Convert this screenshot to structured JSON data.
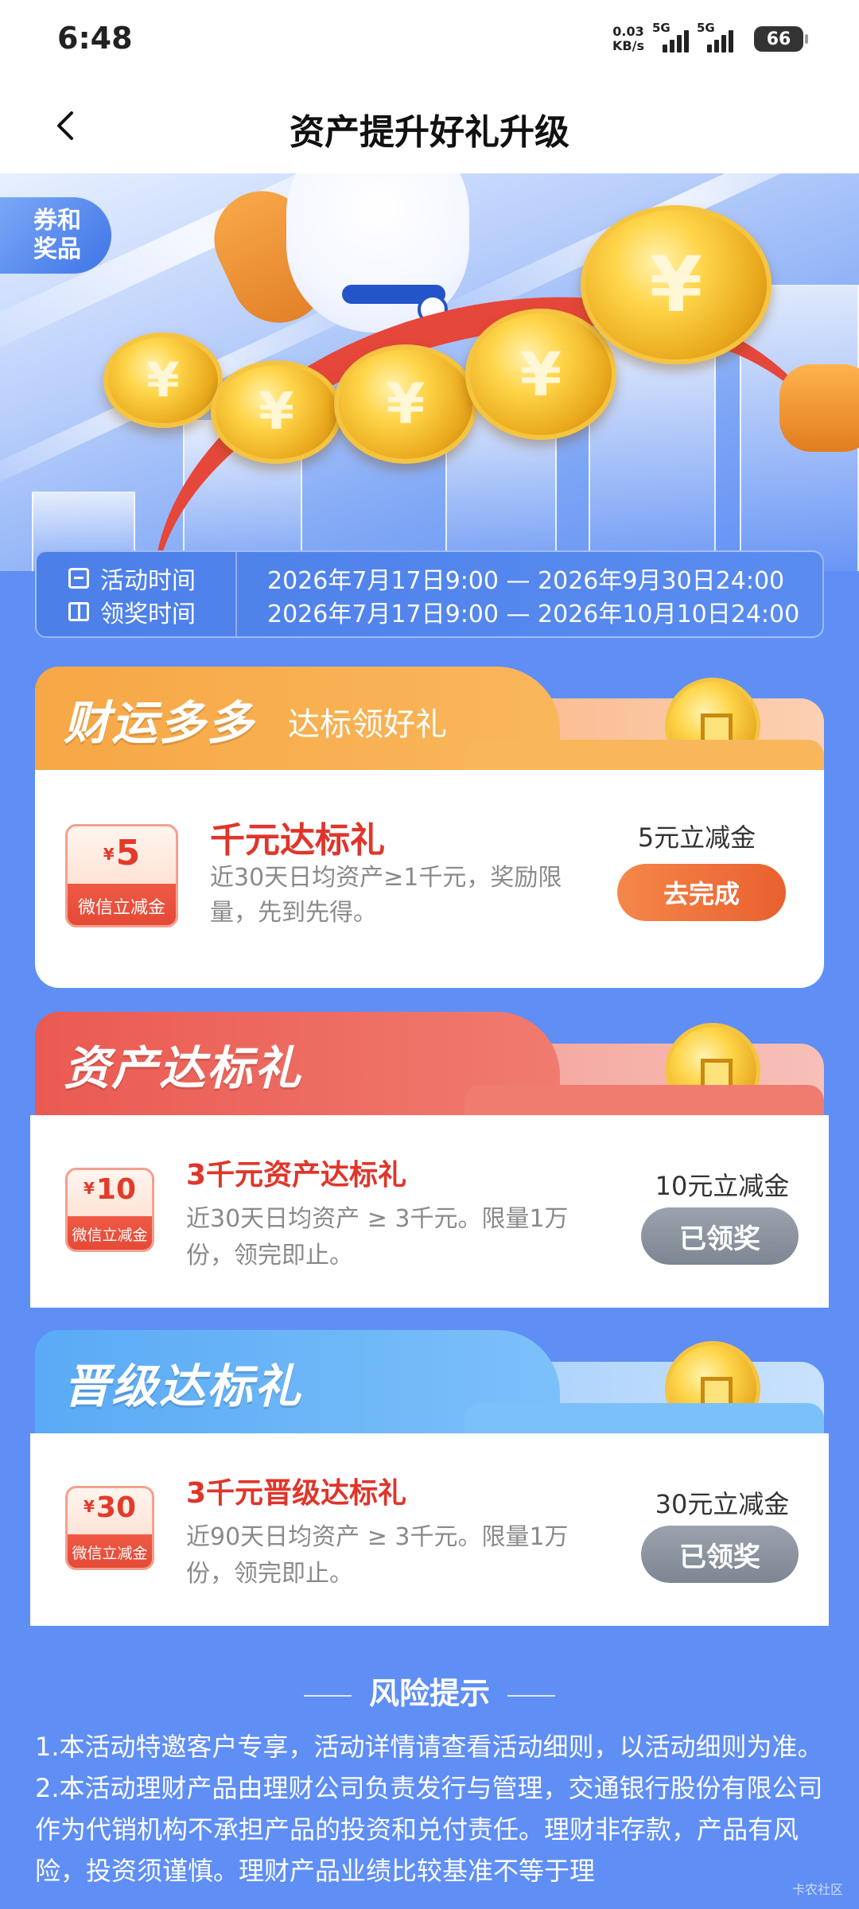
{
  "status_bar": {
    "time": "6:48",
    "net_speed_value": "0.03",
    "net_speed_unit": "KB/s",
    "signal_1_label": "5G",
    "signal_2_label": "5G",
    "battery": "66"
  },
  "header": {
    "title": "资产提升好礼升级"
  },
  "hero": {
    "tag_line1": "券和",
    "tag_line2": "奖品"
  },
  "times": {
    "activity_label": "活动时间",
    "activity_value": "2026年7月17日9:00 — 2026年9月30日24:00",
    "claim_label": "领奖时间",
    "claim_value": "2026年7月17日9:00 — 2026年10月10日24:00"
  },
  "sections": [
    {
      "title": "财运多多",
      "subtitle": "达标领好礼",
      "color": "#f7a746",
      "item": {
        "voucher_amount": "5",
        "voucher_label": "微信立减金",
        "title": "千元达标礼",
        "desc_line1": "近30天日均资产≥1千元，奖励限",
        "desc_line2": "量，先到先得。",
        "reward": "5元立减金",
        "button": "去完成"
      }
    },
    {
      "title": "资产达标礼",
      "subtitle": "",
      "color": "#ea5a52",
      "item": {
        "voucher_amount": "10",
        "voucher_label": "微信立减金",
        "title": "3千元资产达标礼",
        "desc_line1": "近30天日均资产 ≥ 3千元。限量1万",
        "desc_line2": "份，领完即止。",
        "reward": "10元立减金",
        "button": "已领奖"
      }
    },
    {
      "title": "晋级达标礼",
      "subtitle": "",
      "color": "#5aaaf5",
      "item": {
        "voucher_amount": "30",
        "voucher_label": "微信立减金",
        "title": "3千元晋级达标礼",
        "desc_line1": "近90天日均资产 ≥ 3千元。限量1万",
        "desc_line2": "份，领完即止。",
        "reward": "30元立减金",
        "button": "已领奖"
      }
    }
  ],
  "risk": {
    "title": "风险提示",
    "p1": "1.本活动特邀客户专享，活动详情请查看活动细则，以活动细则为准。",
    "p2": "2.本活动理财产品由理财公司负责发行与管理，交通银行股份有限公司作为代销机构不承担产品的投资和兑付责任。理财非存款，产品有风险，投资须谨慎。理财产品业绩比较基准不等于理"
  },
  "watermark": "卡农社区"
}
